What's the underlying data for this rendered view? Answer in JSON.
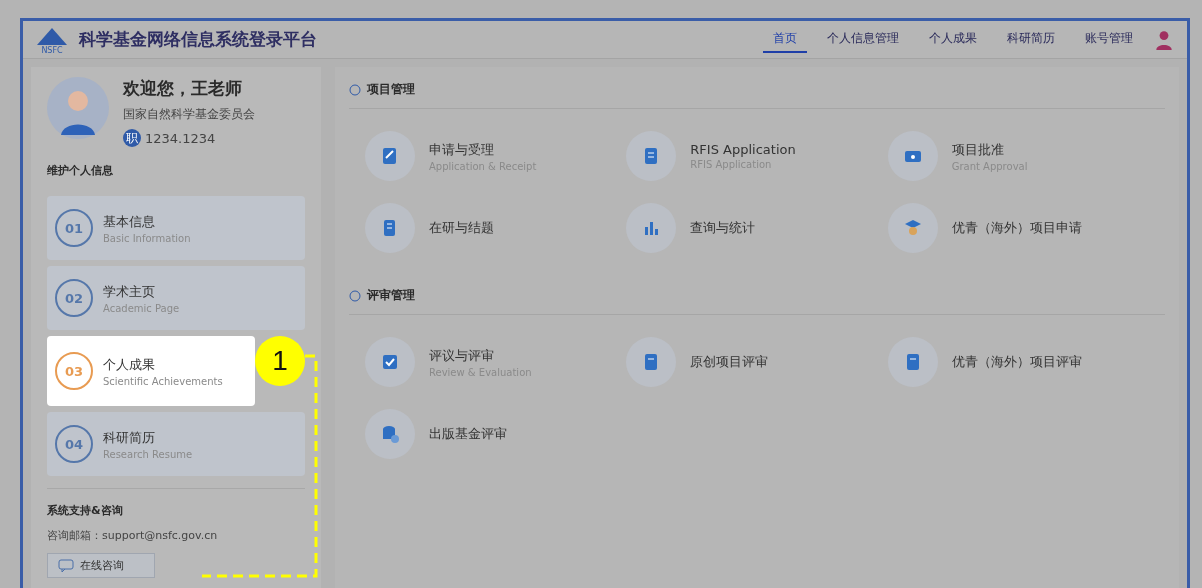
{
  "header": {
    "logo_text": "NSFC",
    "title": "科学基金网络信息系统登录平台",
    "nav": [
      {
        "label": "首页",
        "selected": true
      },
      {
        "label": "个人信息管理",
        "selected": false
      },
      {
        "label": "个人成果",
        "selected": false
      },
      {
        "label": "科研简历",
        "selected": false
      },
      {
        "label": "账号管理",
        "selected": false
      }
    ]
  },
  "profile": {
    "greeting": "欢迎您，王老师",
    "organization": "国家自然科学基金委员会",
    "id_badge": "职",
    "id": "1234.1234"
  },
  "sidebar": {
    "heading": "维护个人信息",
    "items": [
      {
        "number": "01",
        "title": "基本信息",
        "subtitle": "Basic Information",
        "highlighted": false
      },
      {
        "number": "02",
        "title": "学术主页",
        "subtitle": "Academic Page",
        "highlighted": false
      },
      {
        "number": "03",
        "title": "个人成果",
        "subtitle": "Scientific Achievements",
        "highlighted": true
      },
      {
        "number": "04",
        "title": "科研简历",
        "subtitle": "Research Resume",
        "highlighted": false
      }
    ],
    "support_heading": "系统支持&咨询",
    "support_email": "咨询邮箱：support@nsfc.gov.cn",
    "consult_button": "在线咨询"
  },
  "callout": {
    "label": "1"
  },
  "sections": [
    {
      "title": "项目管理",
      "cards": [
        {
          "title": "申请与受理",
          "subtitle": "Application & Receipt"
        },
        {
          "title": "RFIS Application",
          "subtitle": "RFIS Application"
        },
        {
          "title": "项目批准",
          "subtitle": "Grant Approval"
        },
        {
          "title": "在研与结题"
        },
        {
          "title": "查询与统计"
        },
        {
          "title": "优青（海外）项目申请"
        }
      ]
    },
    {
      "title": "评审管理",
      "cards": [
        {
          "title": "评议与评审",
          "subtitle": "Review & Evaluation"
        },
        {
          "title": "原创项目评审"
        },
        {
          "title": "优青（海外）项目评审"
        },
        {
          "title": "出版基金评审"
        }
      ]
    }
  ]
}
